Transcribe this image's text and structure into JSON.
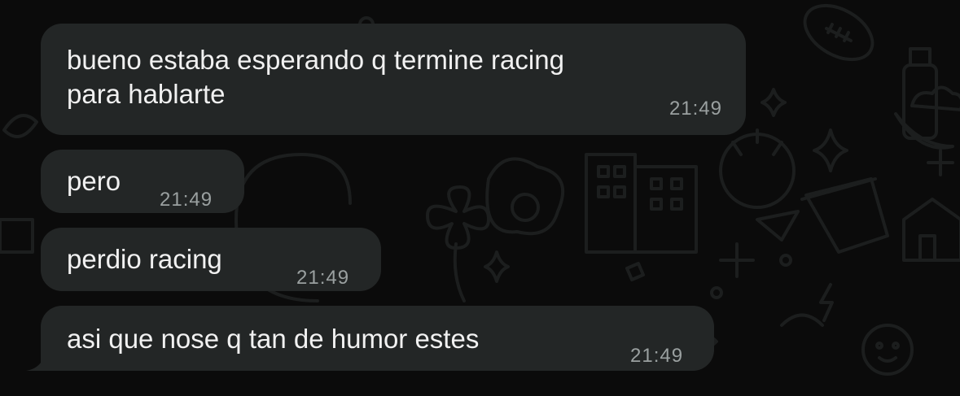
{
  "messages": [
    {
      "text": "bueno estaba esperando q termine racing\npara hablarte",
      "time": "21:49"
    },
    {
      "text": "pero",
      "time": "21:49"
    },
    {
      "text": "perdio racing",
      "time": "21:49"
    },
    {
      "text": "asi que nose q tan de humor estes",
      "time": "21:49"
    }
  ],
  "colors": {
    "background": "#0b0b0b",
    "bubble": "#232626",
    "text": "#f1f1f1",
    "timestamp": "#9aa0a0",
    "doodle": "#1c1e1e"
  }
}
